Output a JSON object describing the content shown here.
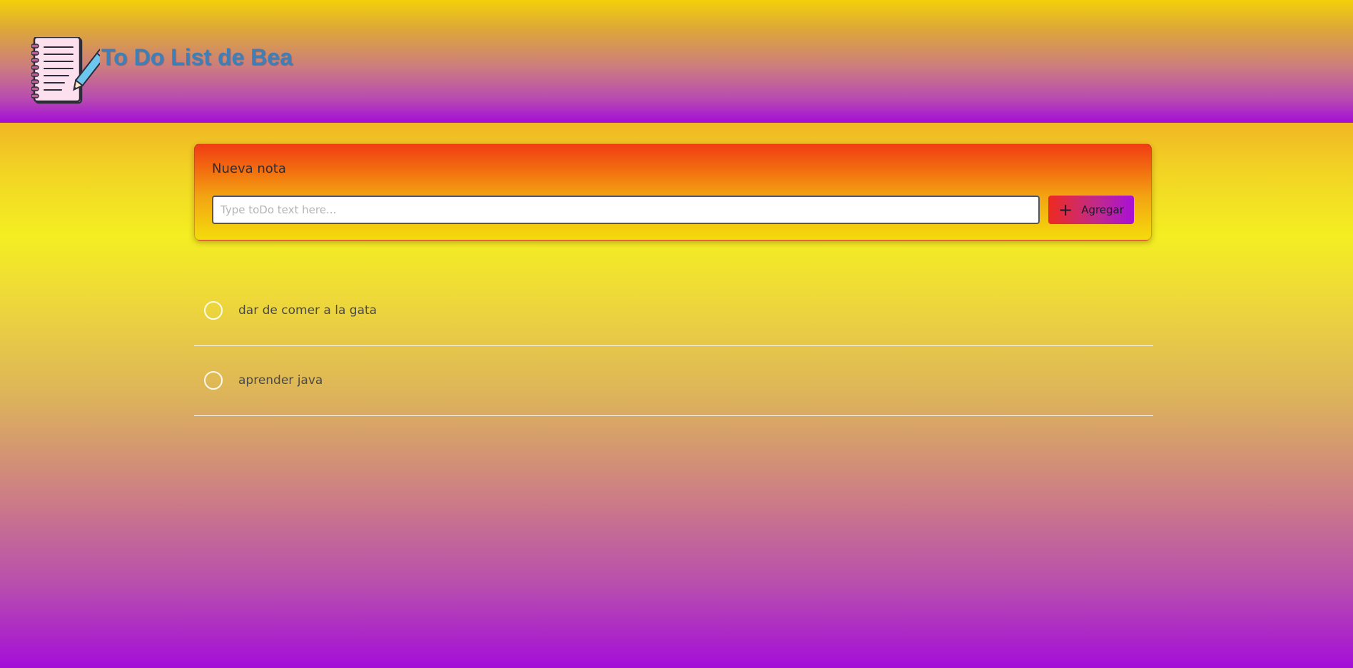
{
  "header": {
    "title": "To Do List de Bea",
    "logo_icon": "notebook-pencil-icon"
  },
  "new_note": {
    "title": "Nueva nota",
    "input_value": "",
    "input_placeholder": "Type toDo text here...",
    "add_icon": "plus-icon",
    "add_icon_glyph": "+",
    "add_label": "Agregar"
  },
  "todos": [
    {
      "text": "dar de comer a la gata",
      "done": false
    },
    {
      "text": "aprender java",
      "done": false
    }
  ],
  "colors": {
    "title_text": "#3f7fb8",
    "header_top": "#f2d00a",
    "header_bottom": "#a40ed6",
    "card_top": "#f03c14",
    "card_bottom": "#f4dc0c",
    "button_left": "#ee2a20",
    "button_right": "#a810d8"
  }
}
